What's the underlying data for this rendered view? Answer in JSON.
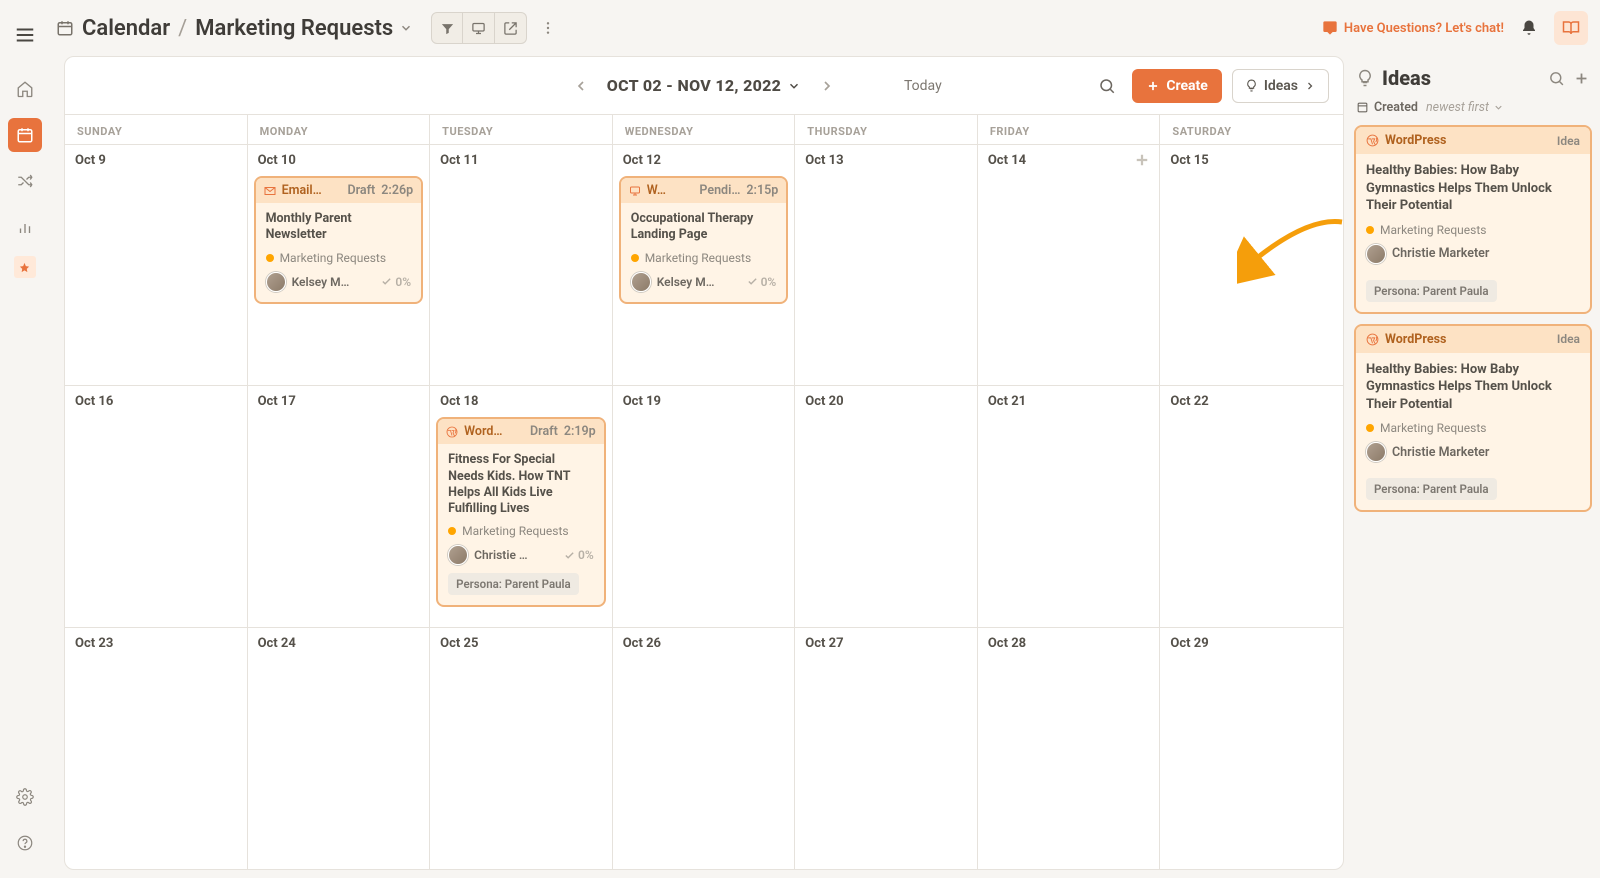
{
  "topbar": {
    "breadcrumb_root": "Calendar",
    "breadcrumb_sub": "Marketing Requests",
    "chat_link": "Have Questions? Let's chat!"
  },
  "calendar": {
    "range_label": "OCT 02 - NOV 12, 2022",
    "today_label": "Today",
    "create_label": "Create",
    "ideas_button_label": "Ideas",
    "weekdays": [
      "SUNDAY",
      "MONDAY",
      "TUESDAY",
      "WEDNESDAY",
      "THURSDAY",
      "FRIDAY",
      "SATURDAY"
    ],
    "rows": [
      [
        "Oct 9",
        "Oct 10",
        "Oct 11",
        "Oct 12",
        "Oct 13",
        "Oct 14",
        "Oct 15"
      ],
      [
        "Oct 16",
        "Oct 17",
        "Oct 18",
        "Oct 19",
        "Oct 20",
        "Oct 21",
        "Oct 22"
      ],
      [
        "Oct 23",
        "Oct 24",
        "Oct 25",
        "Oct 26",
        "Oct 27",
        "Oct 28",
        "Oct 29"
      ]
    ],
    "events": {
      "r0c1": {
        "type_icon": "mail-icon",
        "type_label": "Email…",
        "status": "Draft",
        "time": "2:26p",
        "title": "Monthly Parent Newsletter",
        "project": "Marketing Requests",
        "assignee": "Kelsey M…",
        "progress": "0%"
      },
      "r0c3": {
        "type_icon": "monitor-icon",
        "type_label": "W…",
        "status": "Pendi…",
        "time": "2:15p",
        "title": "Occupational Therapy Landing Page",
        "project": "Marketing Requests",
        "assignee": "Kelsey M…",
        "progress": "0%"
      },
      "r1c2": {
        "type_icon": "wordpress-icon",
        "type_label": "Word…",
        "status": "Draft",
        "time": "2:19p",
        "title": "Fitness For Special Needs Kids. How TNT Helps All Kids Live Fulfilling Lives",
        "project": "Marketing Requests",
        "assignee": "Christie …",
        "progress": "0%",
        "persona": "Persona: Parent Paula"
      }
    }
  },
  "ideas_pane": {
    "title": "Ideas",
    "sort_kind": "Created",
    "sort_order": "newest first",
    "cards": [
      {
        "type": "WordPress",
        "badge": "Idea",
        "title": "Healthy Babies: How Baby Gymnastics Helps Them Unlock Their Potential",
        "project": "Marketing Requests",
        "author": "Christie Marketer",
        "persona": "Persona: Parent Paula"
      },
      {
        "type": "WordPress",
        "badge": "Idea",
        "title": "Healthy Babies: How Baby Gymnastics Helps Them Unlock Their Potential",
        "project": "Marketing Requests",
        "author": "Christie Marketer",
        "persona": "Persona: Parent Paula"
      }
    ]
  }
}
